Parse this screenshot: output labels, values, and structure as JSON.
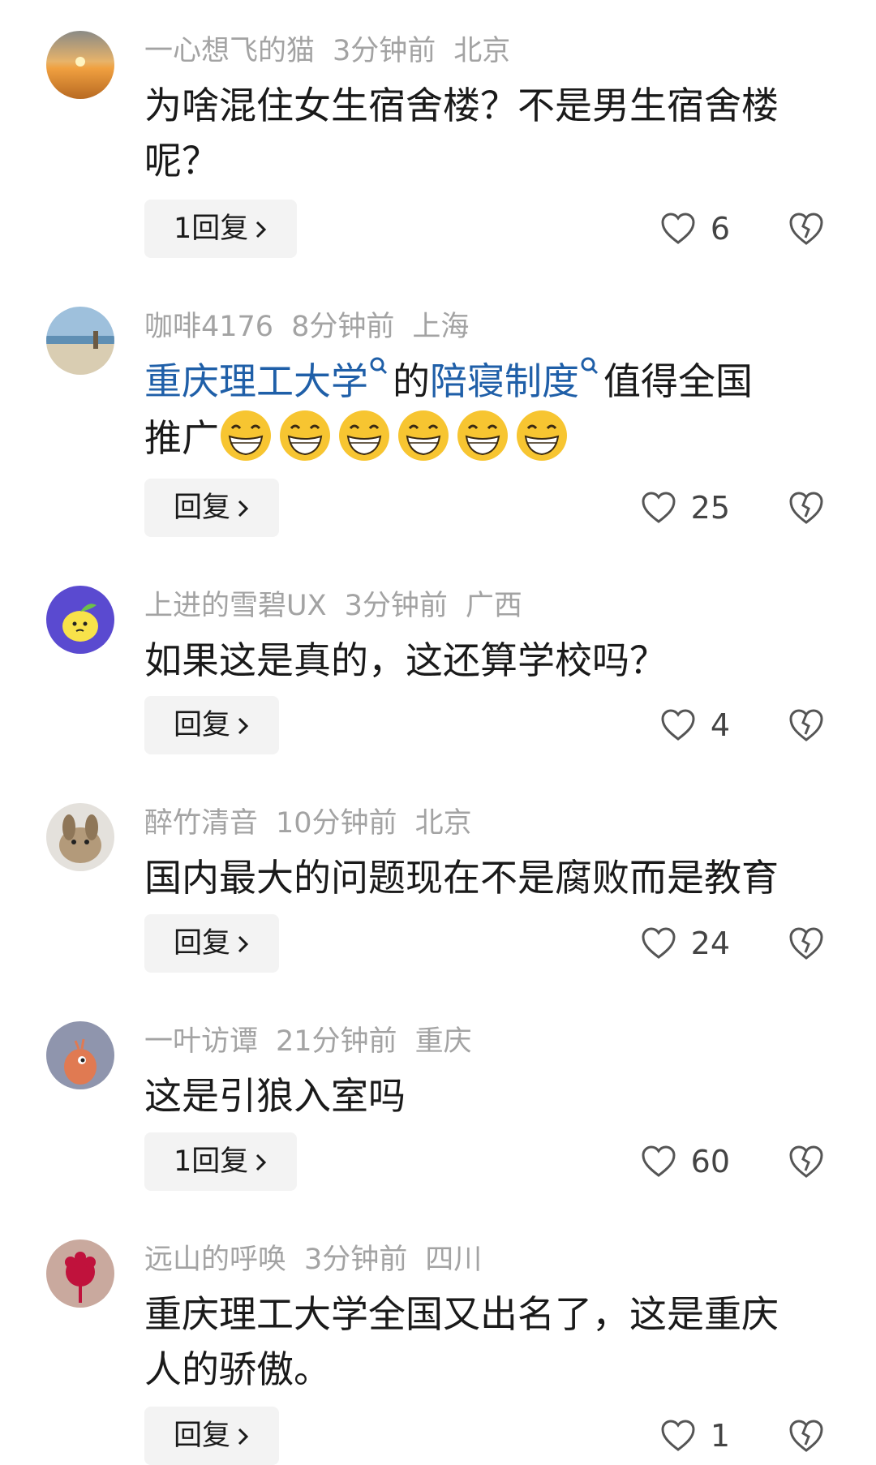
{
  "colors": {
    "link": "#1f5fa8",
    "meta": "#a3a3a3",
    "reply_bg": "#f3f3f3"
  },
  "comments": [
    {
      "avatar": "sunset-avatar",
      "username": "一心想飞的猫",
      "time": "3分钟前",
      "location": "北京",
      "text_line1": "为啥混住女生宿舍楼？不是男生宿舍楼",
      "text_line2": "呢？",
      "reply_label": "1回复",
      "likes": "6"
    },
    {
      "avatar": "beach-avatar",
      "username": "咖啡4176",
      "time": "8分钟前",
      "location": "上海",
      "link1": "重庆理工大学",
      "mid": "的",
      "link2": "陪寝制度",
      "tail": "值得全国",
      "text_line2": "推广",
      "emoji": "grin-emoji",
      "reply_label": "回复",
      "likes": "25"
    },
    {
      "avatar": "lemon-avatar",
      "username": "上进的雪碧UX",
      "time": "3分钟前",
      "location": "广西",
      "text_line1": "如果这是真的，这还算学校吗？",
      "reply_label": "回复",
      "likes": "4"
    },
    {
      "avatar": "rabbit-avatar",
      "username": "醉竹清音",
      "time": "10分钟前",
      "location": "北京",
      "text_line1": "国内最大的问题现在不是腐败而是教育",
      "reply_label": "回复",
      "likes": "24"
    },
    {
      "avatar": "cartoon-avatar",
      "username": "一叶访谭",
      "time": "21分钟前",
      "location": "重庆",
      "text_line1": "这是引狼入室吗",
      "reply_label": "1回复",
      "likes": "60"
    },
    {
      "avatar": "flower-avatar",
      "username": "远山的呼唤",
      "time": "3分钟前",
      "location": "四川",
      "text_line1": "重庆理工大学全国又出名了，这是重庆",
      "text_line2": "人的骄傲。",
      "reply_label": "回复",
      "likes": "1"
    }
  ]
}
